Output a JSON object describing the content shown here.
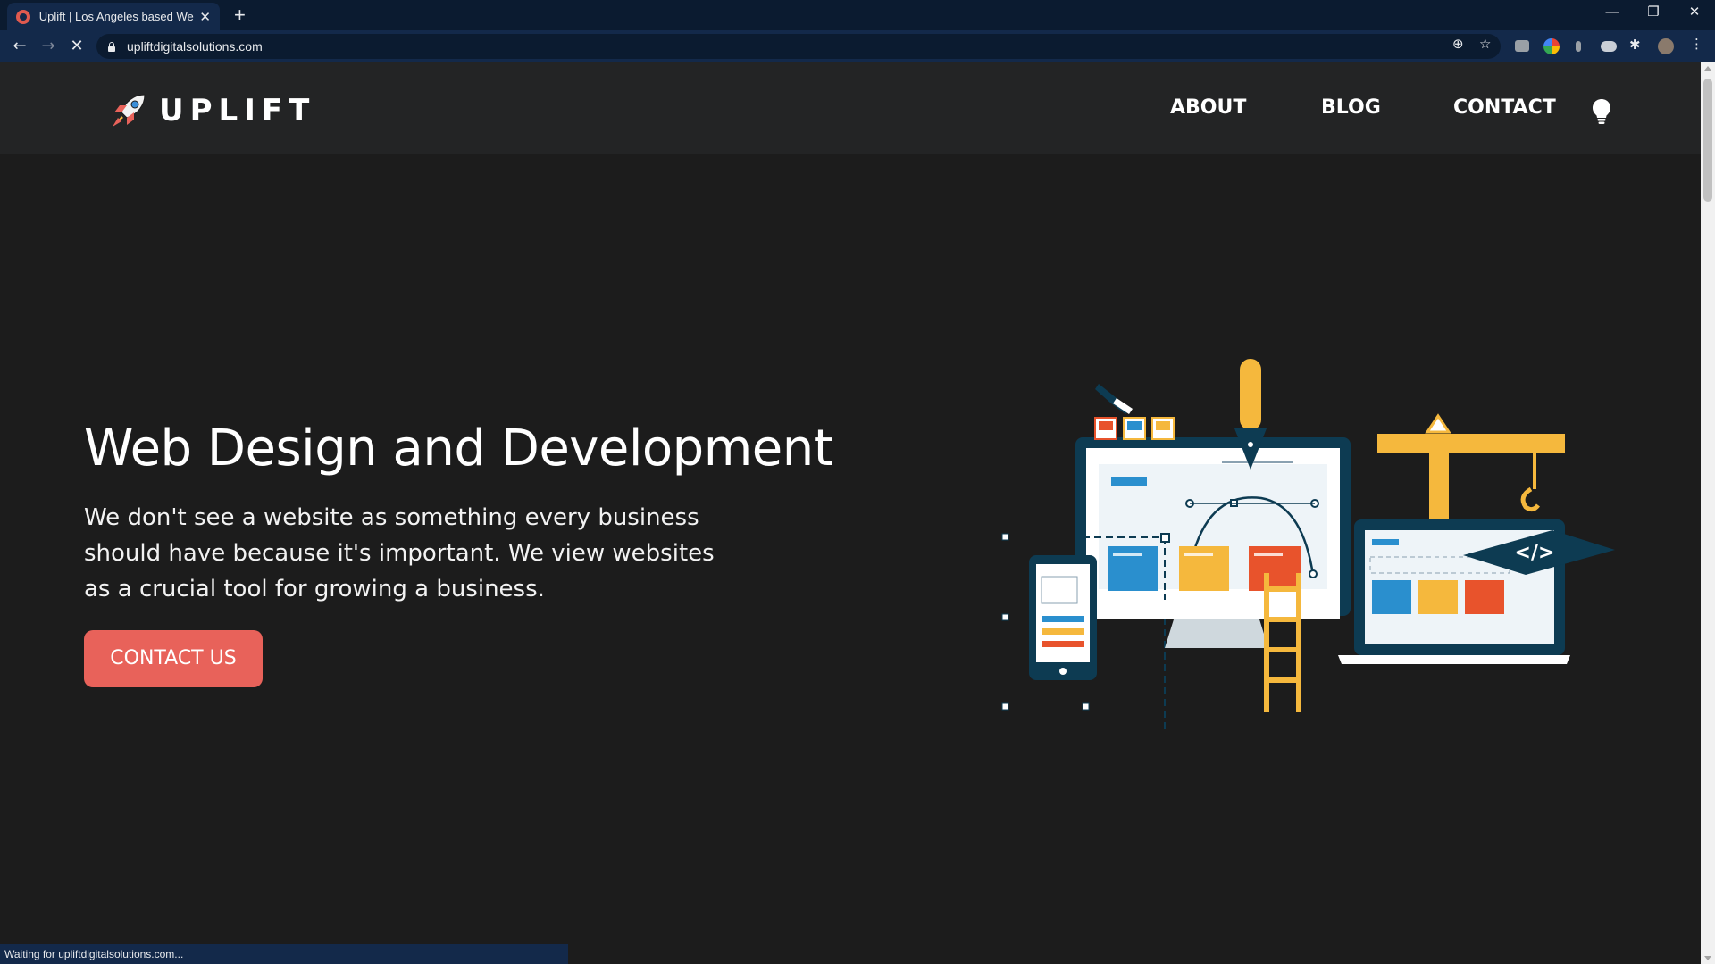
{
  "browser": {
    "tab_title": "Uplift | Los Angeles based Web D",
    "new_tab": "+",
    "url": "upliftdigitalsolutions.com",
    "status_text": "Waiting for upliftdigitalsolutions.com..."
  },
  "site": {
    "brand": "UPLIFT",
    "nav": {
      "about": "ABOUT",
      "blog": "BLOG",
      "contact": "CONTACT"
    },
    "hero": {
      "title": "Web Design and Development",
      "text": "We don't see a website as something every business should have because it's important. We view websites as a crucial tool for growing a business.",
      "cta": "CONTACT US"
    },
    "illustration": {
      "code_tag": "</>"
    }
  },
  "colors": {
    "page_bg": "#1c1c1c",
    "nav_bg": "#232425",
    "accent": "#e8625a",
    "chrome_bg": "#0b1b30"
  }
}
